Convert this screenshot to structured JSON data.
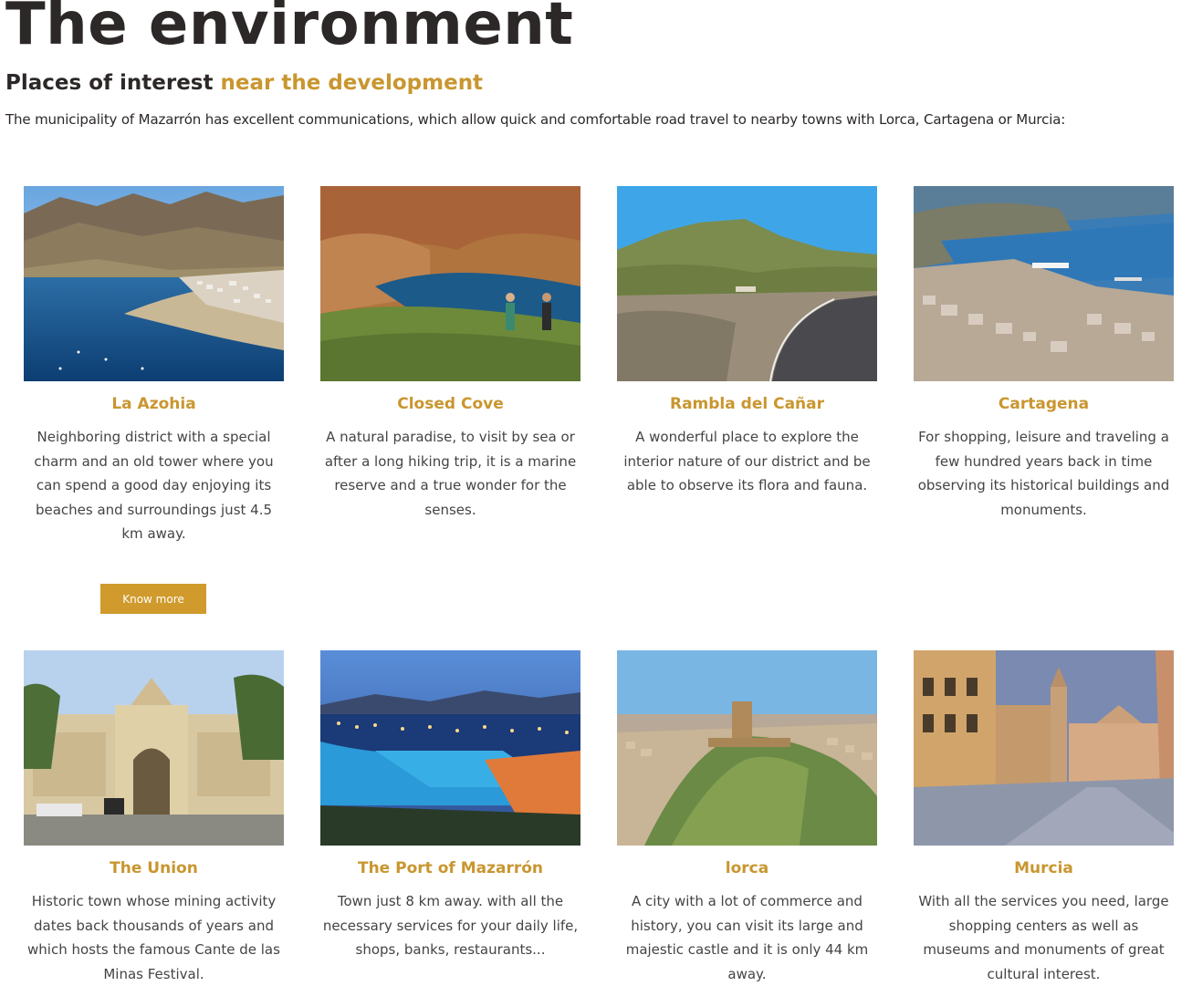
{
  "header": {
    "title": "The environment",
    "subtitle_plain": "Places of interest ",
    "subtitle_accent": "near the development",
    "intro": "The municipality of Mazarrón has excellent communications, which allow quick and comfortable road travel to nearby towns with Lorca, Cartagena or Murcia:"
  },
  "colors": {
    "accent": "#c9962f",
    "button": "#d09a2c",
    "heading": "#2d2828"
  },
  "places": [
    {
      "title": "La Azohia",
      "description": "Neighboring district with a special charm and an old tower where you can spend a good day enjoying its beaches and surroundings just 4.5 km away.",
      "image": "coastal-bay-photo"
    },
    {
      "title": "Closed Cove",
      "description": "A natural paradise, to visit by sea or after a long hiking trip, it is a marine reserve and a true wonder for the senses.",
      "image": "cove-hikers-photo"
    },
    {
      "title": "Rambla del Cañar",
      "description": "A wonderful place to explore the interior nature of our district and be able to observe its flora and fauna.",
      "image": "mountain-road-photo"
    },
    {
      "title": "Cartagena",
      "description": "For shopping, leisure and traveling a few hundred years back in time observing its historical buildings and monuments.",
      "image": "harbor-city-photo"
    },
    {
      "title": "The Union",
      "description": "Historic town whose mining activity dates back thousands of years and which hosts the famous Cante de las Minas Festival.",
      "image": "historic-market-photo"
    },
    {
      "title": "The Port of Mazarrón",
      "description": "Town just 8 km away. with all the necessary services for your daily life, shops, banks, restaurants...",
      "image": "night-port-photo"
    },
    {
      "title": "lorca",
      "description": "A city with a lot of commerce and history, you can visit its large and majestic castle and it is only 44 km away.",
      "image": "hill-castle-photo"
    },
    {
      "title": "Murcia",
      "description": "With all the services you need, large shopping centers as well as museums and monuments of great cultural interest.",
      "image": "cathedral-square-photo"
    }
  ],
  "button": {
    "label": "Know more"
  }
}
